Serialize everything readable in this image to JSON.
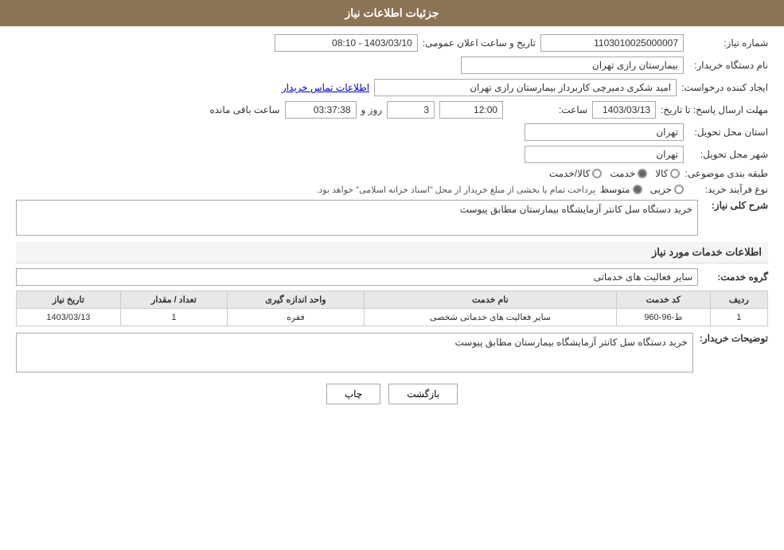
{
  "page": {
    "header_title": "جزئیات اطلاعات نیاز",
    "fields": {
      "need_number_label": "شماره نیاز:",
      "need_number_value": "1103010025000007",
      "date_label": "تاریخ و ساعت اعلان عمومی:",
      "date_value": "1403/03/10 - 08:10",
      "buyer_name_label": "نام دستگاه خریدار:",
      "buyer_name_value": "بیمارستان رازی تهران",
      "creator_label": "ایجاد کننده درخواست:",
      "creator_value": "امید شکری دمیرچی کاربرداز بیمارستان رازی تهران",
      "creator_link": "اطلاعات تماس خریدار",
      "response_deadline_label": "مهلت ارسال پاسخ: تا تاریخ:",
      "response_date_value": "1403/03/13",
      "response_time_label": "ساعت:",
      "response_time_value": "12:00",
      "remaining_days_label": "روز و",
      "remaining_days_value": "3",
      "remaining_time_value": "03:37:38",
      "remaining_suffix": "ساعت باقی مانده",
      "province_label": "استان محل تحویل:",
      "province_value": "تهران",
      "city_label": "شهر محل تحویل:",
      "city_value": "تهران",
      "category_label": "طبقه بندی موضوعی:",
      "cat_options": [
        "کالا",
        "خدمت",
        "کالا/خدمت"
      ],
      "cat_selected": "خدمت",
      "process_label": "نوع فرآیند خرید:",
      "process_options": [
        "جزیی",
        "متوسط",
        ""
      ],
      "process_note": "پرداخت تمام یا بخشی از مبلغ خریدار از محل \"اسناد خزانه اسلامی\" خواهد بود.",
      "need_description_title": "شرح کلی نیاز:",
      "need_description_value": "خرید دستگاه سل کانتر آزمایشگاه بیمارستان مطابق پیوست",
      "services_title": "اطلاعات خدمات مورد نیاز",
      "service_group_label": "گروه خدمت:",
      "service_group_value": "سایر فعالیت های خدماتی",
      "table": {
        "headers": [
          "ردیف",
          "کد خدمت",
          "نام خدمت",
          "واحد اندازه گیری",
          "تعداد / مقدار",
          "تاریخ نیاز"
        ],
        "rows": [
          {
            "row": "1",
            "code": "ط-96-960",
            "name": "سایر فعالیت های خدماتی شخصی",
            "unit": "فقره",
            "count": "1",
            "date": "1403/03/13"
          }
        ]
      },
      "buyer_desc_label": "توضیحات خریدار:",
      "buyer_desc_value": "خرید دستگاه سل کانتر آزمایشگاه بیمارستان مطابق پیوست"
    },
    "buttons": {
      "print": "چاپ",
      "back": "بازگشت"
    }
  }
}
